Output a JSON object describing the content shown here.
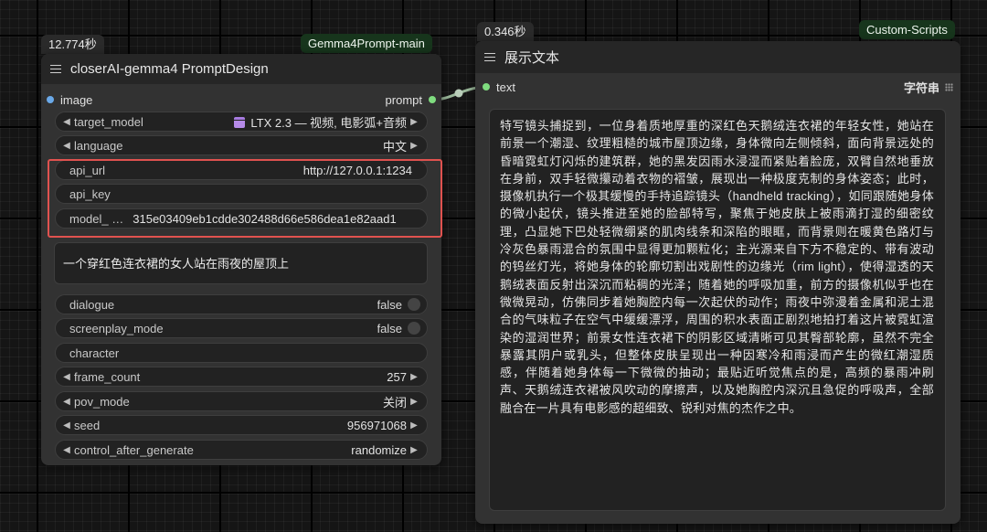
{
  "left_node": {
    "timing": "12.774秒",
    "pack": "Gemma4Prompt-main",
    "title": "closerAI-gemma4 PromptDesign",
    "input_slot": "image",
    "output_slot": "prompt",
    "widgets": {
      "target_model": {
        "label": "target_model",
        "value": "LTX 2.3 — 视频, 电影弧+音频"
      },
      "language": {
        "label": "language",
        "value": "中文"
      },
      "api_url": {
        "label": "api_url",
        "value": "http://127.0.0.1:1234"
      },
      "api_key": {
        "label": "api_key",
        "value": ""
      },
      "model": {
        "label": "model_ …",
        "value": "315e03409eb1cdde302488d66e586dea1e82aad1"
      },
      "dialogue": {
        "label": "dialogue",
        "value": "false"
      },
      "screenplay_mode": {
        "label": "screenplay_mode",
        "value": "false"
      },
      "character": {
        "label": "character",
        "value": ""
      },
      "frame_count": {
        "label": "frame_count",
        "value": "257"
      },
      "pov_mode": {
        "label": "pov_mode",
        "value": "关闭"
      },
      "seed": {
        "label": "seed",
        "value": "956971068"
      },
      "control_after_generate": {
        "label": "control_after_generate",
        "value": "randomize"
      }
    },
    "prompt_text": "一个穿红色连衣裙的女人站在雨夜的屋顶上"
  },
  "right_node": {
    "timing": "0.346秒",
    "pack": "Custom-Scripts",
    "title": "展示文本",
    "input_slot": "text",
    "type_label": "字符串",
    "text": "特写镜头捕捉到，一位身着质地厚重的深红色天鹅绒连衣裙的年轻女性，她站在前景一个潮湿、纹理粗糙的城市屋顶边缘，身体微向左侧倾斜，面向背景远处的昏暗霓虹灯闪烁的建筑群，她的黑发因雨水浸湿而紧贴着脸庞，双臂自然地垂放在身前，双手轻微攥动着衣物的褶皱，展现出一种极度克制的身体姿态；此时，摄像机执行一个极其缓慢的手持追踪镜头（handheld tracking），如同跟随她身体的微小起伏，镜头推进至她的脸部特写，聚焦于她皮肤上被雨滴打湿的细密纹理，凸显她下巴处轻微绷紧的肌肉线条和深陷的眼眶，而背景则在暖黄色路灯与冷灰色暴雨混合的氛围中显得更加颗粒化；主光源来自下方不稳定的、带有波动的钨丝灯光，将她身体的轮廓切割出戏剧性的边缘光（rim light），使得湿透的天鹅绒表面反射出深沉而粘稠的光泽；随着她的呼吸加重，前方的摄像机似乎也在微微晃动，仿佛同步着她胸腔内每一次起伏的动作；雨夜中弥漫着金属和泥土混合的气味粒子在空气中缓缓漂浮，周围的积水表面正剧烈地拍打着这片被霓虹渲染的湿润世界；前景女性连衣裙下的阴影区域清晰可见其臀部轮廓，虽然不完全暴露其阴户或乳头，但整体皮肤呈现出一种因寒冷和雨浸而产生的微红潮湿质感，伴随着她身体每一下微微的抽动；最贴近听觉焦点的是，高频的暴雨冲刷声、天鹅绒连衣裙被风吹动的摩擦声，以及她胸腔内深沉且急促的呼吸声，全部融合在一片具有电影感的超细致、锐利对焦的杰作之中。"
  },
  "colors": {
    "highlight": "#e0524f",
    "link": "#9ab89a",
    "output_dot": "#7fdc7f",
    "input_dot": "#6aa9e9"
  }
}
